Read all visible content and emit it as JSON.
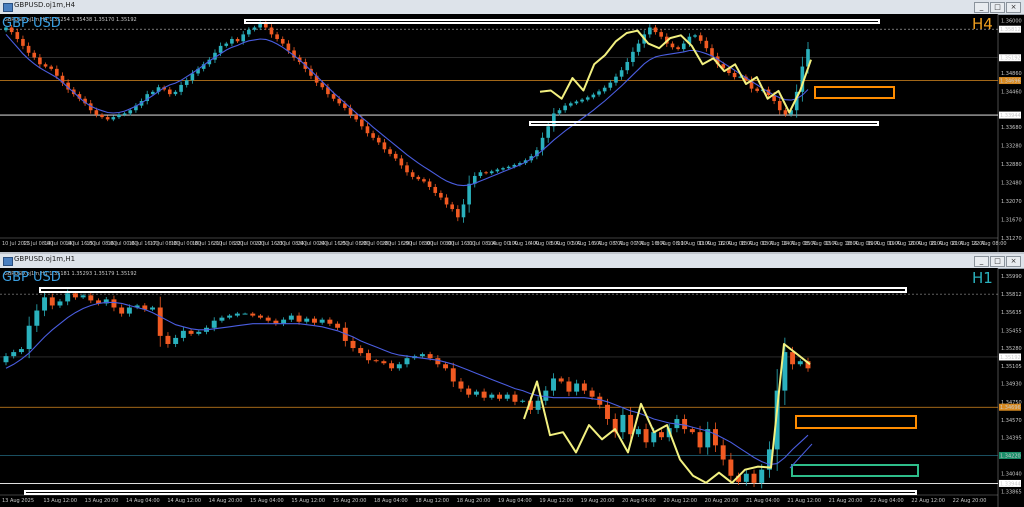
{
  "windows": [
    {
      "title": "GBPUSD.oj1m,H4",
      "buttons": [
        "_",
        "□",
        "×"
      ],
      "ohlc": "GBPUSD.oj1m,H4  1.35254 1.35438 1.35170 1.35192"
    },
    {
      "title": "GBPUSD.oj1m,H1",
      "buttons": [
        "_",
        "□",
        "×"
      ],
      "ohlc": "GBPUSD.oj1m,H1  1.35181 1.35293 1.35179 1.35192"
    }
  ],
  "colors": {
    "bull": "#2ab1bd",
    "bear": "#f05a22",
    "ma": "#4a5de0",
    "zigzag": "#f2f080",
    "orange_box": "#ff8c00",
    "green_box": "#2ebd8a",
    "white_line": "#ffffff",
    "orange_line": "#d98a20",
    "h4_label": "#f0a020",
    "h1_label": "#2ab1bd"
  },
  "chart_data": [
    {
      "type": "candlestick",
      "symbol": "GBP USD",
      "timeframe": "H4",
      "ylim": [
        1.3127,
        1.361
      ],
      "price_labels": [
        "1.36000",
        "1.35812",
        "1.35192",
        "1.34860",
        "1.34696",
        "1.34460",
        "1.33944",
        "1.33680",
        "1.33280",
        "1.32880",
        "1.32480",
        "1.32070",
        "1.31670",
        "1.31270"
      ],
      "price_values": [
        1.36,
        1.35812,
        1.35192,
        1.3486,
        1.34696,
        1.3446,
        1.33944,
        1.3368,
        1.3328,
        1.3288,
        1.3248,
        1.3207,
        1.3167,
        1.3127
      ],
      "highlight_prices": {
        "current": "1.35192",
        "level_top": "1.35812",
        "level_orange": "1.34696",
        "level_bottom": "1.33944"
      },
      "x_labels": [
        "10 Jul 2025",
        "11 Jul 08:00",
        "14 Jul 00:00",
        "14 Jul 16:00",
        "15 Jul 08:00",
        "16 Jul 00:00",
        "16 Jul 16:00",
        "17 Jul 08:00",
        "18 Jul 00:00",
        "18 Jul 16:00",
        "21 Jul 08:00",
        "22 Jul 00:00",
        "22 Jul 16:00",
        "23 Jul 08:00",
        "24 Jul 00:00",
        "24 Jul 16:00",
        "25 Jul 08:00",
        "28 Jul 00:00",
        "28 Jul 16:00",
        "29 Jul 08:00",
        "30 Jul 00:00",
        "30 Jul 16:00",
        "31 Jul 08:00",
        "1 Aug 00:00",
        "1 Aug 16:00",
        "4 Aug 08:00",
        "5 Aug 00:00",
        "5 Aug 16:00",
        "6 Aug 08:00",
        "7 Aug 00:00",
        "7 Aug 16:00",
        "8 Aug 08:00",
        "11 Aug 00:00",
        "11 Aug 16:00",
        "12 Aug 08:00",
        "13 Aug 00:00",
        "13 Aug 16:00",
        "14 Aug 08:00",
        "15 Aug 00:00",
        "15 Aug 16:00",
        "18 Aug 08:00",
        "19 Aug 00:00",
        "19 Aug 16:00",
        "20 Aug 08:00",
        "21 Aug 00:00",
        "21 Aug 16:00",
        "22 Aug 08:00"
      ],
      "closes": [
        1.3585,
        1.3575,
        1.356,
        1.3545,
        1.353,
        1.352,
        1.3505,
        1.35,
        1.3495,
        1.348,
        1.3465,
        1.345,
        1.344,
        1.343,
        1.342,
        1.3405,
        1.3395,
        1.339,
        1.3385,
        1.339,
        1.3395,
        1.3398,
        1.3405,
        1.3415,
        1.3425,
        1.344,
        1.3445,
        1.3455,
        1.345,
        1.344,
        1.3445,
        1.346,
        1.347,
        1.3485,
        1.3495,
        1.3505,
        1.3515,
        1.353,
        1.3545,
        1.355,
        1.356,
        1.3555,
        1.357,
        1.358,
        1.3585,
        1.3595,
        1.3585,
        1.357,
        1.356,
        1.355,
        1.3535,
        1.352,
        1.351,
        1.3495,
        1.348,
        1.3465,
        1.3455,
        1.344,
        1.343,
        1.342,
        1.341,
        1.3395,
        1.3385,
        1.337,
        1.3355,
        1.3345,
        1.3335,
        1.332,
        1.331,
        1.33,
        1.3285,
        1.327,
        1.326,
        1.3255,
        1.325,
        1.3238,
        1.3225,
        1.3215,
        1.32,
        1.319,
        1.3172,
        1.32,
        1.3245,
        1.3262,
        1.327,
        1.3268,
        1.3272,
        1.3276,
        1.3279,
        1.3282,
        1.3286,
        1.329,
        1.3296,
        1.3305,
        1.3318,
        1.3345,
        1.337,
        1.3398,
        1.3405,
        1.3415,
        1.342,
        1.3424,
        1.3428,
        1.3433,
        1.3439,
        1.3446,
        1.3454,
        1.3465,
        1.3478,
        1.3492,
        1.351,
        1.3532,
        1.355,
        1.357,
        1.3585,
        1.3575,
        1.3565,
        1.355,
        1.3542,
        1.3538,
        1.355,
        1.3565,
        1.3568,
        1.3556,
        1.354,
        1.3522,
        1.3505,
        1.3496,
        1.3486,
        1.3477,
        1.3478,
        1.347,
        1.3452,
        1.3447,
        1.345,
        1.3438,
        1.3425,
        1.3405,
        1.3396,
        1.3405,
        1.3445,
        1.35,
        1.3538
      ],
      "zigzag": [
        1.3445,
        1.3448,
        1.343,
        1.3475,
        1.3448,
        1.3505,
        1.3525,
        1.3555,
        1.3573,
        1.3578,
        1.355,
        1.354,
        1.3562,
        1.3568,
        1.3545,
        1.3505,
        1.3518,
        1.349,
        1.3505,
        1.3462,
        1.3477,
        1.343,
        1.3447,
        1.34,
        1.3448,
        1.3515
      ],
      "ma": [
        1.357,
        1.3556,
        1.3542,
        1.3528,
        1.3516,
        1.3506,
        1.3497,
        1.349,
        1.3483,
        1.3476,
        1.3466,
        1.3454,
        1.3444,
        1.3432,
        1.3422,
        1.3414,
        1.3408,
        1.3404,
        1.34,
        1.3399,
        1.34,
        1.3403,
        1.3408,
        1.3414,
        1.3421,
        1.3429,
        1.3437,
        1.3446,
        1.3454,
        1.346,
        1.3464,
        1.347,
        1.3478,
        1.3486,
        1.3494,
        1.3503,
        1.3512,
        1.352,
        1.3528,
        1.3536,
        1.3542,
        1.3546,
        1.3552,
        1.3556,
        1.3558,
        1.356,
        1.3559,
        1.3555,
        1.3549,
        1.3542,
        1.3533,
        1.3524,
        1.3514,
        1.3503,
        1.3491,
        1.3479,
        1.3467,
        1.3455,
        1.3443,
        1.3432,
        1.3421,
        1.341,
        1.3399,
        1.3389,
        1.3379,
        1.3368,
        1.3358,
        1.3348,
        1.3338,
        1.3328,
        1.3318,
        1.3308,
        1.3299,
        1.329,
        1.3282,
        1.3274,
        1.3266,
        1.3258,
        1.3251,
        1.3246,
        1.3242,
        1.3241,
        1.3242,
        1.3246,
        1.3251,
        1.3256,
        1.3261,
        1.3266,
        1.3271,
        1.3276,
        1.3281,
        1.3286,
        1.3292,
        1.3299,
        1.3308,
        1.3318,
        1.3329,
        1.334,
        1.335,
        1.336,
        1.3369,
        1.3378,
        1.3387,
        1.3396,
        1.3405,
        1.3415,
        1.3425,
        1.3436,
        1.3447,
        1.3458,
        1.347,
        1.3482,
        1.3494,
        1.3506,
        1.3515,
        1.3521,
        1.3524,
        1.3526,
        1.3528,
        1.353,
        1.3532,
        1.3535,
        1.3535,
        1.3532,
        1.3528,
        1.3523,
        1.3516,
        1.3508,
        1.35,
        1.3492,
        1.3484,
        1.3476,
        1.3468,
        1.346,
        1.3452,
        1.3445,
        1.3438,
        1.3432,
        1.3428,
        1.3427,
        1.343,
        1.3438,
        1.345
      ],
      "levels": {
        "top_dotted": 1.35812,
        "current": 1.35192,
        "orange": 1.34696,
        "bottom": 1.33944
      },
      "annotation_label": "GBP USD",
      "timeframe_label": "H4"
    },
    {
      "type": "candlestick",
      "symbol": "GBP USD",
      "timeframe": "H1",
      "ylim": [
        1.3383,
        1.3605
      ],
      "price_labels": [
        "1.35990",
        "1.35812",
        "1.35635",
        "1.35455",
        "1.35280",
        "1.35192",
        "1.35105",
        "1.34930",
        "1.34750",
        "1.34696",
        "1.34570",
        "1.34395",
        "1.34220",
        "1.34040",
        "1.33944",
        "1.33865"
      ],
      "price_values": [
        1.3599,
        1.35812,
        1.35635,
        1.35455,
        1.3528,
        1.35192,
        1.35105,
        1.3493,
        1.3475,
        1.34696,
        1.3457,
        1.34395,
        1.3422,
        1.3404,
        1.33944,
        1.33865
      ],
      "highlight_prices": {
        "current": "1.35192",
        "level_orange": "1.34696",
        "level_teal": "1.34220",
        "level_bottom": "1.33944"
      },
      "x_labels": [
        "13 Aug 2025",
        "13 Aug 12:00",
        "13 Aug 20:00",
        "14 Aug 04:00",
        "14 Aug 12:00",
        "14 Aug 20:00",
        "15 Aug 04:00",
        "15 Aug 12:00",
        "15 Aug 20:00",
        "18 Aug 04:00",
        "18 Aug 12:00",
        "18 Aug 20:00",
        "19 Aug 04:00",
        "19 Aug 12:00",
        "19 Aug 20:00",
        "20 Aug 04:00",
        "20 Aug 12:00",
        "20 Aug 20:00",
        "21 Aug 04:00",
        "21 Aug 12:00",
        "21 Aug 20:00",
        "22 Aug 04:00",
        "22 Aug 12:00",
        "22 Aug 20:00"
      ],
      "closes": [
        1.352,
        1.3524,
        1.3527,
        1.355,
        1.3565,
        1.3578,
        1.357,
        1.3574,
        1.3582,
        1.3578,
        1.358,
        1.3575,
        1.3572,
        1.3576,
        1.3568,
        1.3562,
        1.3568,
        1.357,
        1.3566,
        1.3568,
        1.354,
        1.3532,
        1.3538,
        1.3545,
        1.3542,
        1.3544,
        1.3548,
        1.3555,
        1.3558,
        1.356,
        1.3562,
        1.3562,
        1.356,
        1.3558,
        1.3555,
        1.3552,
        1.3556,
        1.356,
        1.3554,
        1.3557,
        1.3553,
        1.3556,
        1.3552,
        1.3548,
        1.3535,
        1.3528,
        1.3523,
        1.3516,
        1.3515,
        1.3513,
        1.3508,
        1.3512,
        1.3518,
        1.352,
        1.3522,
        1.3518,
        1.3512,
        1.3508,
        1.3495,
        1.3488,
        1.3482,
        1.3485,
        1.3479,
        1.3482,
        1.3478,
        1.3482,
        1.3475,
        1.3476,
        1.3467,
        1.3476,
        1.3486,
        1.3498,
        1.3495,
        1.3485,
        1.3493,
        1.3486,
        1.348,
        1.3472,
        1.3458,
        1.3445,
        1.3462,
        1.3443,
        1.3448,
        1.3435,
        1.3445,
        1.344,
        1.3449,
        1.3458,
        1.3448,
        1.3445,
        1.343,
        1.3448,
        1.3432,
        1.3418,
        1.3402,
        1.3396,
        1.3404,
        1.3395,
        1.3408,
        1.3428,
        1.3486,
        1.3524,
        1.3512,
        1.3515,
        1.3508
      ],
      "zigzag": [
        1.3458,
        1.3495,
        1.3442,
        1.3445,
        1.3425,
        1.3452,
        1.3438,
        1.3448,
        1.3425,
        1.3473,
        1.3445,
        1.3452,
        1.3418,
        1.3402,
        1.3395,
        1.3405,
        1.3395,
        1.3408,
        1.3411,
        1.341,
        1.3532,
        1.3522,
        1.3512
      ],
      "ma": [
        1.3508,
        1.3512,
        1.3517,
        1.3523,
        1.3531,
        1.3539,
        1.3546,
        1.3552,
        1.3558,
        1.3563,
        1.3567,
        1.357,
        1.3572,
        1.3573,
        1.3573,
        1.3572,
        1.357,
        1.3568,
        1.3566,
        1.3563,
        1.3559,
        1.3555,
        1.3551,
        1.3549,
        1.3547,
        1.3546,
        1.3546,
        1.3547,
        1.3548,
        1.3549,
        1.355,
        1.3551,
        1.3552,
        1.3552,
        1.3552,
        1.3552,
        1.3552,
        1.3552,
        1.3552,
        1.3551,
        1.355,
        1.3549,
        1.3547,
        1.3545,
        1.3542,
        1.3539,
        1.3535,
        1.3532,
        1.3529,
        1.3526,
        1.3523,
        1.3521,
        1.352,
        1.3519,
        1.3518,
        1.3517,
        1.3516,
        1.3514,
        1.3512,
        1.3509,
        1.3506,
        1.3503,
        1.35,
        1.3497,
        1.3494,
        1.3491,
        1.3488,
        1.3486,
        1.3483,
        1.3481,
        1.348,
        1.3479,
        1.3479,
        1.3479,
        1.3479,
        1.3479,
        1.3478,
        1.3477,
        1.3475,
        1.3472,
        1.3469,
        1.3466,
        1.3464,
        1.3461,
        1.3458,
        1.3456,
        1.3454,
        1.3453,
        1.3452,
        1.345,
        1.3448,
        1.3446,
        1.3443,
        1.3439,
        1.3435,
        1.343,
        1.3425,
        1.342,
        1.3416,
        1.3413,
        1.3414,
        1.342,
        1.3428,
        1.3435,
        1.3442
      ],
      "levels": {
        "top_dotted": 1.35812,
        "current": 1.35192,
        "orange": 1.34696,
        "teal": 1.3422,
        "bottom": 1.33944
      },
      "annotation_label": "GBP USD",
      "timeframe_label": "H1"
    }
  ]
}
